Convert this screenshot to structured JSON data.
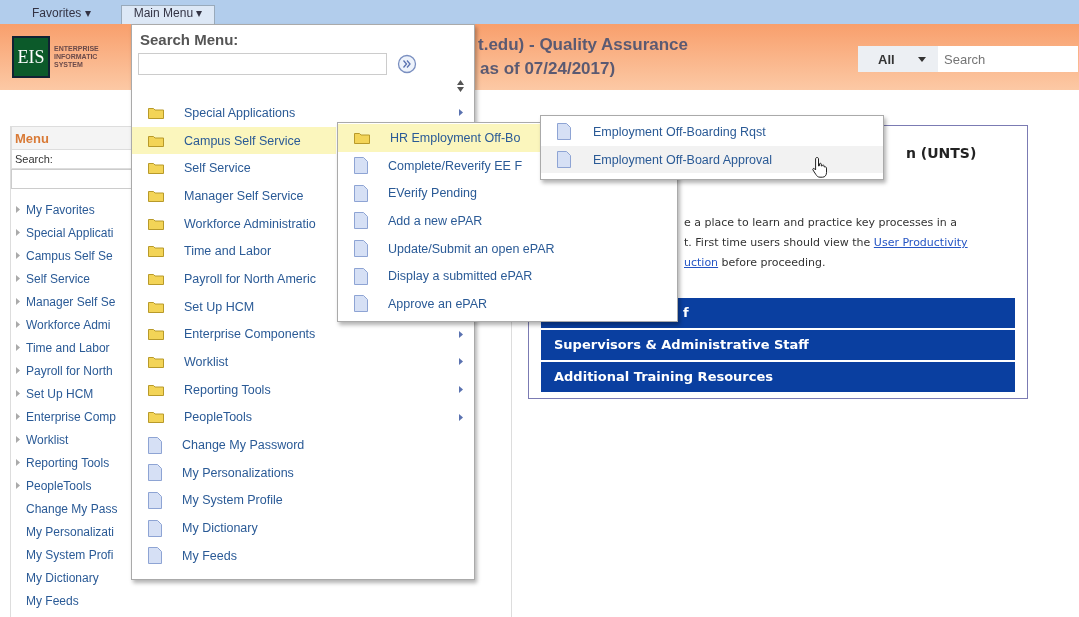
{
  "nav_tabs": [
    {
      "label": "Favorites ▾",
      "selected": false
    },
    {
      "label": "Main Menu ▾",
      "selected": true
    }
  ],
  "header": {
    "logo": "EIS",
    "logo_lines": [
      "ENTERPRISE",
      "INFORMATIC",
      "SYSTEM"
    ],
    "title_lines": [
      "t.edu) - Quality Assurance",
      "as of 07/24/2017)"
    ],
    "search_scope": "All",
    "search_placeholder": "Search"
  },
  "sidebar": {
    "title": "Menu",
    "search_label": "Search:",
    "items": [
      {
        "label": "My Favorites",
        "kind": "folder"
      },
      {
        "label": "Special Applicati",
        "kind": "folder"
      },
      {
        "label": "Campus Self Se",
        "kind": "folder"
      },
      {
        "label": "Self Service",
        "kind": "folder"
      },
      {
        "label": "Manager Self Se",
        "kind": "folder"
      },
      {
        "label": "Workforce Admi",
        "kind": "folder"
      },
      {
        "label": "Time and Labor",
        "kind": "folder"
      },
      {
        "label": "Payroll for North",
        "kind": "folder"
      },
      {
        "label": "Set Up HCM",
        "kind": "folder"
      },
      {
        "label": "Enterprise Comp",
        "kind": "folder"
      },
      {
        "label": "Worklist",
        "kind": "folder"
      },
      {
        "label": "Reporting Tools",
        "kind": "folder"
      },
      {
        "label": "PeopleTools",
        "kind": "folder"
      },
      {
        "label": "Change My Pass",
        "kind": "page"
      },
      {
        "label": "My Personalizati",
        "kind": "page"
      },
      {
        "label": "My System Profi",
        "kind": "page"
      },
      {
        "label": "My Dictionary",
        "kind": "page"
      },
      {
        "label": "My Feeds",
        "kind": "page"
      }
    ]
  },
  "content": {
    "title": "n (UNTS)",
    "paragraph_lines": [
      [
        {
          "text": "e a place to learn and practice key processes in a",
          "link": false
        }
      ],
      [
        {
          "text": "t. First time users should view the ",
          "link": false
        },
        {
          "text": "User Productivity",
          "link": true
        }
      ],
      [
        {
          "text": "uction",
          "link": true
        },
        {
          "text": " before proceeding.",
          "link": false
        }
      ]
    ],
    "bars": [
      {
        "label": "f",
        "kind": "partial"
      },
      {
        "label": "Supervisors & Administrative Staff",
        "kind": "full"
      },
      {
        "label": "Additional Training Resources",
        "kind": "full"
      }
    ]
  },
  "main_menu": {
    "search_label": "Search Menu:",
    "items": [
      {
        "label": "Special Applications",
        "kind": "folder",
        "selected": false,
        "arrow": true
      },
      {
        "label": "Campus Self Service",
        "kind": "folder",
        "selected": true,
        "arrow": false
      },
      {
        "label": "Self Service",
        "kind": "folder",
        "selected": false,
        "arrow": false
      },
      {
        "label": "Manager Self Service",
        "kind": "folder",
        "selected": false,
        "arrow": false
      },
      {
        "label": "Workforce Administratio",
        "kind": "folder",
        "selected": false,
        "arrow": false
      },
      {
        "label": "Time and Labor",
        "kind": "folder",
        "selected": false,
        "arrow": false
      },
      {
        "label": "Payroll for North Americ",
        "kind": "folder",
        "selected": false,
        "arrow": false
      },
      {
        "label": "Set Up HCM",
        "kind": "folder",
        "selected": false,
        "arrow": false
      },
      {
        "label": "Enterprise Components",
        "kind": "folder",
        "selected": false,
        "arrow": true
      },
      {
        "label": "Worklist",
        "kind": "folder",
        "selected": false,
        "arrow": true
      },
      {
        "label": "Reporting Tools",
        "kind": "folder",
        "selected": false,
        "arrow": true
      },
      {
        "label": "PeopleTools",
        "kind": "folder",
        "selected": false,
        "arrow": true
      },
      {
        "label": "Change My Password",
        "kind": "page",
        "selected": false,
        "arrow": false
      },
      {
        "label": "My Personalizations",
        "kind": "page",
        "selected": false,
        "arrow": false
      },
      {
        "label": "My System Profile",
        "kind": "page",
        "selected": false,
        "arrow": false
      },
      {
        "label": "My Dictionary",
        "kind": "page",
        "selected": false,
        "arrow": false
      },
      {
        "label": "My Feeds",
        "kind": "page",
        "selected": false,
        "arrow": false
      }
    ]
  },
  "submenu": {
    "items": [
      {
        "label": "HR Employment Off-Bo",
        "kind": "folder",
        "selected": true
      },
      {
        "label": "Complete/Reverify EE F",
        "kind": "page",
        "selected": false
      },
      {
        "label": "EVerify Pending",
        "kind": "page",
        "selected": false
      },
      {
        "label": "Add a new ePAR",
        "kind": "page",
        "selected": false
      },
      {
        "label": "Update/Submit an open ePAR",
        "kind": "page",
        "selected": false
      },
      {
        "label": "Display a submitted ePAR",
        "kind": "page",
        "selected": false
      },
      {
        "label": "Approve an ePAR",
        "kind": "page",
        "selected": false
      }
    ]
  },
  "sub_submenu": {
    "items": [
      {
        "label": "Employment Off-Boarding Rqst",
        "kind": "page",
        "selected": false
      },
      {
        "label": "Employment Off-Board Approval",
        "kind": "page",
        "selected": true
      }
    ]
  }
}
